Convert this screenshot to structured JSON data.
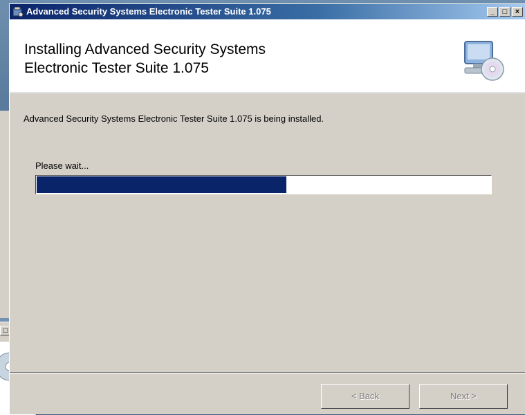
{
  "window": {
    "title": "Advanced Security Systems Electronic Tester Suite 1.075",
    "controls": {
      "minimize": "_",
      "maximize": "□",
      "close": "×"
    }
  },
  "header": {
    "title_line1": "Installing Advanced Security Systems",
    "title_line2": "Electronic Tester Suite 1.075",
    "icon": "computer-cd-icon"
  },
  "body": {
    "description": "Advanced Security Systems Electronic Tester Suite 1.075 is being installed.",
    "wait_label": "Please wait...",
    "progress_fraction": 0.55
  },
  "buttons": {
    "back_label": "< Back",
    "next_label": "Next >"
  },
  "background_window": {
    "controls": {
      "maximize": "□",
      "close": "×"
    }
  },
  "colors": {
    "titlebar_start": "#0a246a",
    "titlebar_end": "#a6caf0",
    "progress_fill": "#0a246a",
    "dialog_bg": "#d4d0c8"
  }
}
